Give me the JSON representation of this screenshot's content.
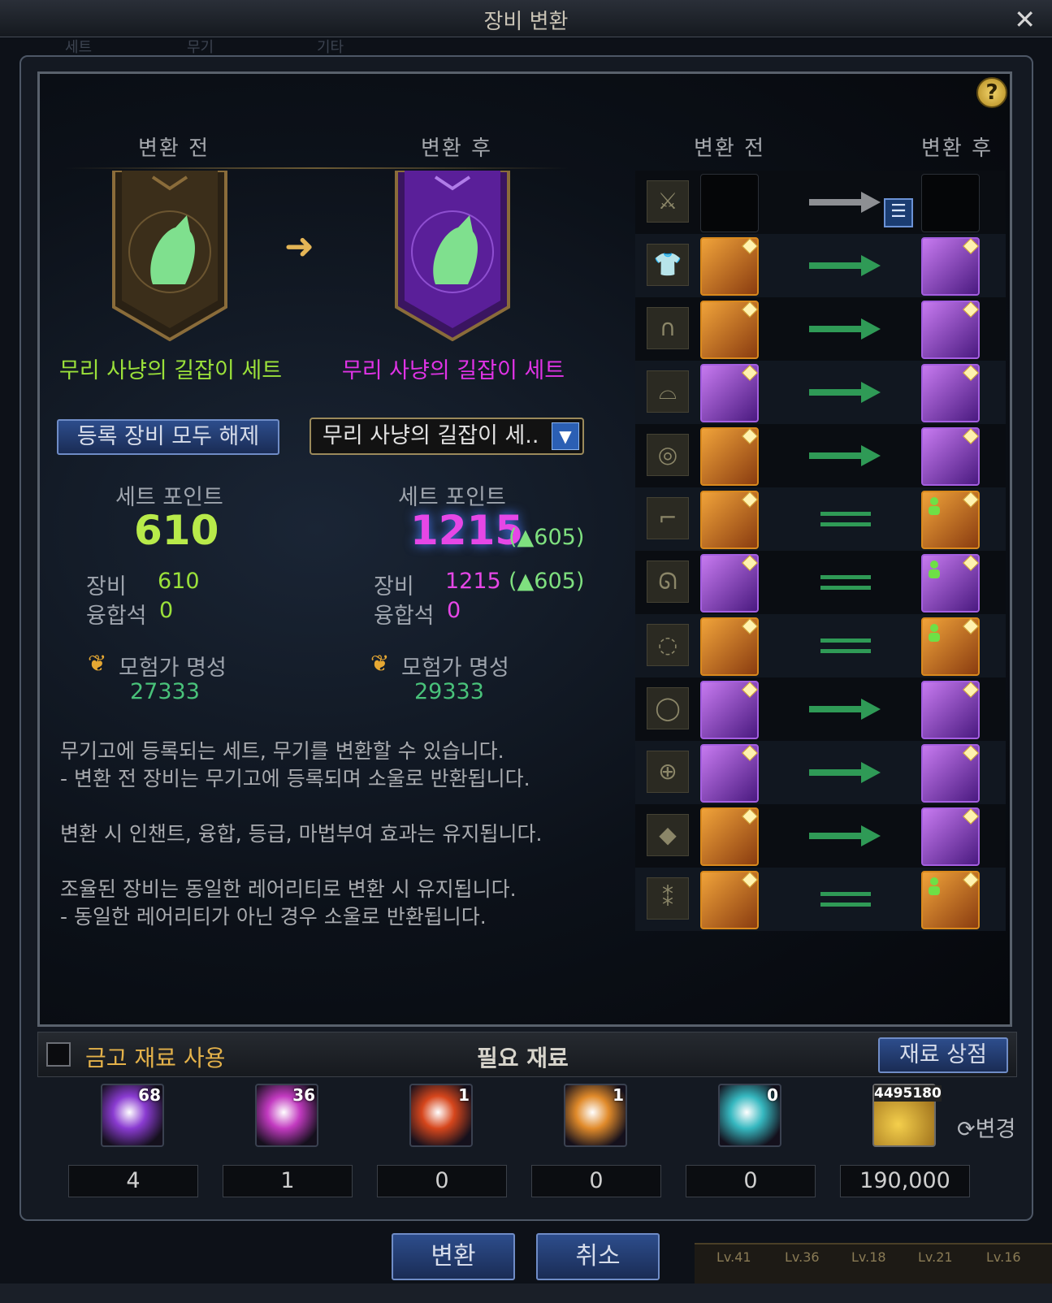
{
  "window": {
    "title": "장비 변환"
  },
  "background_tabs": [
    "세트",
    "무기",
    "기타"
  ],
  "left": {
    "before_header": "변환 전",
    "after_header": "변환 후",
    "before_set_name": "무리 사냥의 길잡이 세트",
    "after_set_name": "무리 사냥의 길잡이 세트",
    "unregister_button": "등록 장비 모두 해제",
    "dropdown_value": "무리 사냥의 길잡이 세..",
    "set_point_label": "세트 포인트",
    "before_points": "610",
    "after_points": "1215",
    "after_points_delta": "(▲605)",
    "equip_label": "장비",
    "before_equip": "610",
    "after_equip": "1215",
    "after_equip_delta": "(▲605)",
    "fusion_label": "융합석",
    "before_fusion": "0",
    "after_fusion": "0",
    "fame_label": "모험가 명성",
    "before_fame": "27333",
    "after_fame": "29333"
  },
  "right": {
    "before_header": "변환 전",
    "after_header": "변환 후",
    "rows": [
      {
        "slot": "weapon",
        "conversion": "arrow-gray",
        "before": "empty",
        "after": "empty"
      },
      {
        "slot": "top",
        "conversion": "arrow-green",
        "before": "orange",
        "after": "purple"
      },
      {
        "slot": "bottom",
        "conversion": "arrow-green",
        "before": "orange",
        "after": "purple"
      },
      {
        "slot": "head",
        "conversion": "arrow-green",
        "before": "purple",
        "after": "purple"
      },
      {
        "slot": "belt",
        "conversion": "arrow-green",
        "before": "orange",
        "after": "purple"
      },
      {
        "slot": "shoes",
        "conversion": "equal",
        "before": "orange",
        "after": "orange"
      },
      {
        "slot": "necklace",
        "conversion": "equal",
        "before": "purple",
        "after": "purple"
      },
      {
        "slot": "bracelet",
        "conversion": "equal",
        "before": "orange",
        "after": "orange"
      },
      {
        "slot": "ring",
        "conversion": "arrow-green",
        "before": "purple",
        "after": "purple"
      },
      {
        "slot": "support",
        "conversion": "arrow-green",
        "before": "purple",
        "after": "purple"
      },
      {
        "slot": "magic-stone",
        "conversion": "arrow-green",
        "before": "orange",
        "after": "purple"
      },
      {
        "slot": "earring",
        "conversion": "equal",
        "before": "orange",
        "after": "orange"
      }
    ]
  },
  "description": [
    "무기고에 등록되는 세트, 무기를 변환할 수 있습니다.",
    "- 변환 전 장비는 무기고에 등록되며 소울로 반환됩니다.",
    "",
    "변환 시 인챈트, 융합, 등급, 마법부여 효과는 유지됩니다.",
    "",
    "조율된 장비는 동일한 레어리티로 변환 시 유지됩니다.",
    "- 동일한 레어리티가 아닌 경우 소울로 반환됩니다."
  ],
  "materials_bar": {
    "use_vault_label": "금고 재료 사용",
    "required_label": "필요 재료",
    "shop_button": "재료 상점"
  },
  "materials": [
    {
      "owned": "68",
      "need": "4",
      "color": "#8a3bd1"
    },
    {
      "owned": "36",
      "need": "1",
      "color": "#c23ac0"
    },
    {
      "owned": "1",
      "need": "0",
      "color": "#d6461c"
    },
    {
      "owned": "1",
      "need": "0",
      "color": "#e08a2a"
    },
    {
      "owned": "0",
      "need": "0",
      "color": "#36b8c0"
    },
    {
      "owned": "4495180",
      "need": "190,000",
      "color": "#d9a21e"
    }
  ],
  "change_label": "변경",
  "buttons": {
    "convert": "변환",
    "cancel": "취소"
  },
  "levels": [
    "Lv.41",
    "Lv.36",
    "Lv.18",
    "Lv.21",
    "Lv.16"
  ]
}
